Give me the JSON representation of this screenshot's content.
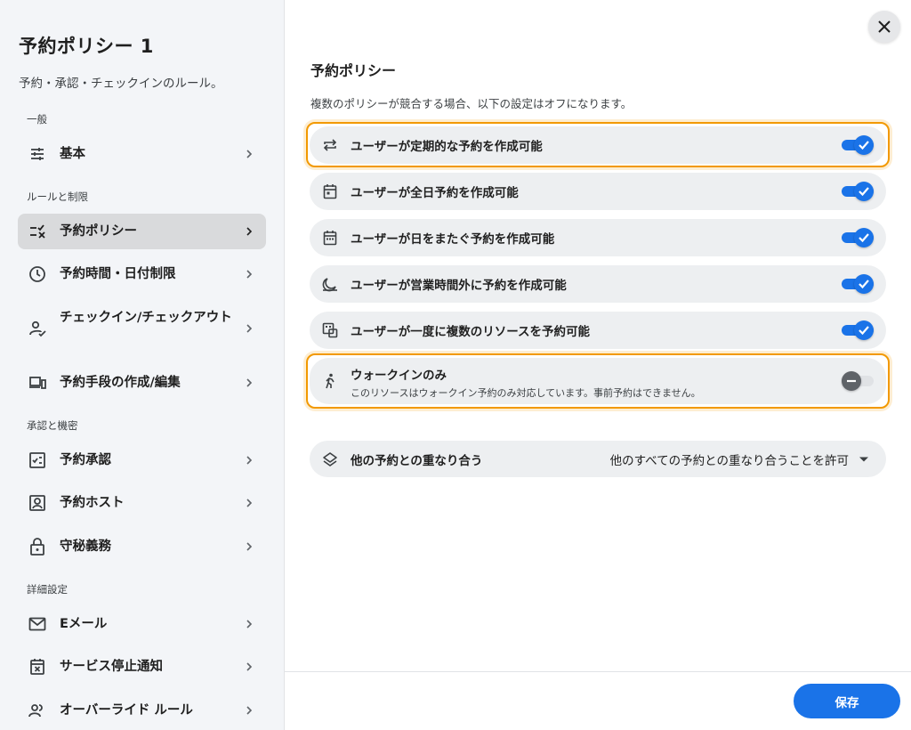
{
  "sidebar": {
    "title": "予約ポリシー 1",
    "subtitle": "予約・承認・チェックインのルール。",
    "sections": [
      {
        "label": "一般"
      },
      {
        "label": "ルールと制限"
      },
      {
        "label": "承認と機密"
      },
      {
        "label": "詳細設定"
      }
    ],
    "items": [
      {
        "label": "基本",
        "icon": "tune-icon"
      },
      {
        "label": "予約ポリシー",
        "icon": "checklist-icon",
        "active": true
      },
      {
        "label": "予約時間・日付制限",
        "icon": "clock-icon"
      },
      {
        "label": "チェックイン/チェックアウト",
        "icon": "person-check-icon"
      },
      {
        "label": "予約手段の作成/編集",
        "icon": "devices-icon"
      },
      {
        "label": "予約承認",
        "icon": "approval-icon"
      },
      {
        "label": "予約ホスト",
        "icon": "account-box-icon"
      },
      {
        "label": "守秘義務",
        "icon": "lock-icon"
      },
      {
        "label": "Eメール",
        "icon": "mail-icon"
      },
      {
        "label": "サービス停止通知",
        "icon": "calendar-x-icon"
      },
      {
        "label": "オーバーライド ルール",
        "icon": "group-icon"
      }
    ]
  },
  "main": {
    "title": "予約ポリシー",
    "description": "複数のポリシーが競合する場合、以下の設定はオフになります。",
    "settings": [
      {
        "label": "ユーザーが定期的な予約を作成可能",
        "icon": "repeat-icon",
        "enabled": true,
        "highlighted": true
      },
      {
        "label": "ユーザーが全日予約を作成可能",
        "icon": "calendar-icon",
        "enabled": true
      },
      {
        "label": "ユーザーが日をまたぐ予約を作成可能",
        "icon": "calendar-range-icon",
        "enabled": true
      },
      {
        "label": "ユーザーが営業時間外に予約を作成可能",
        "icon": "night-icon",
        "enabled": true
      },
      {
        "label": "ユーザーが一度に複数のリソースを予約可能",
        "icon": "multi-resource-icon",
        "enabled": true
      },
      {
        "label": "ウォークインのみ",
        "sublabel": "このリソースはウォークイン予約のみ対応しています。事前予約はできません。",
        "icon": "walk-icon",
        "enabled": false,
        "highlighted": true
      }
    ],
    "overlap": {
      "label": "他の予約との重なり合う",
      "value": "他のすべての予約との重なり合うことを許可",
      "icon": "layers-icon"
    }
  },
  "footer": {
    "save_label": "保存"
  },
  "colors": {
    "accent": "#1a73e8",
    "highlight": "#f29900",
    "sidebar_bg": "#f3f5f8",
    "row_bg": "#edeff1"
  }
}
